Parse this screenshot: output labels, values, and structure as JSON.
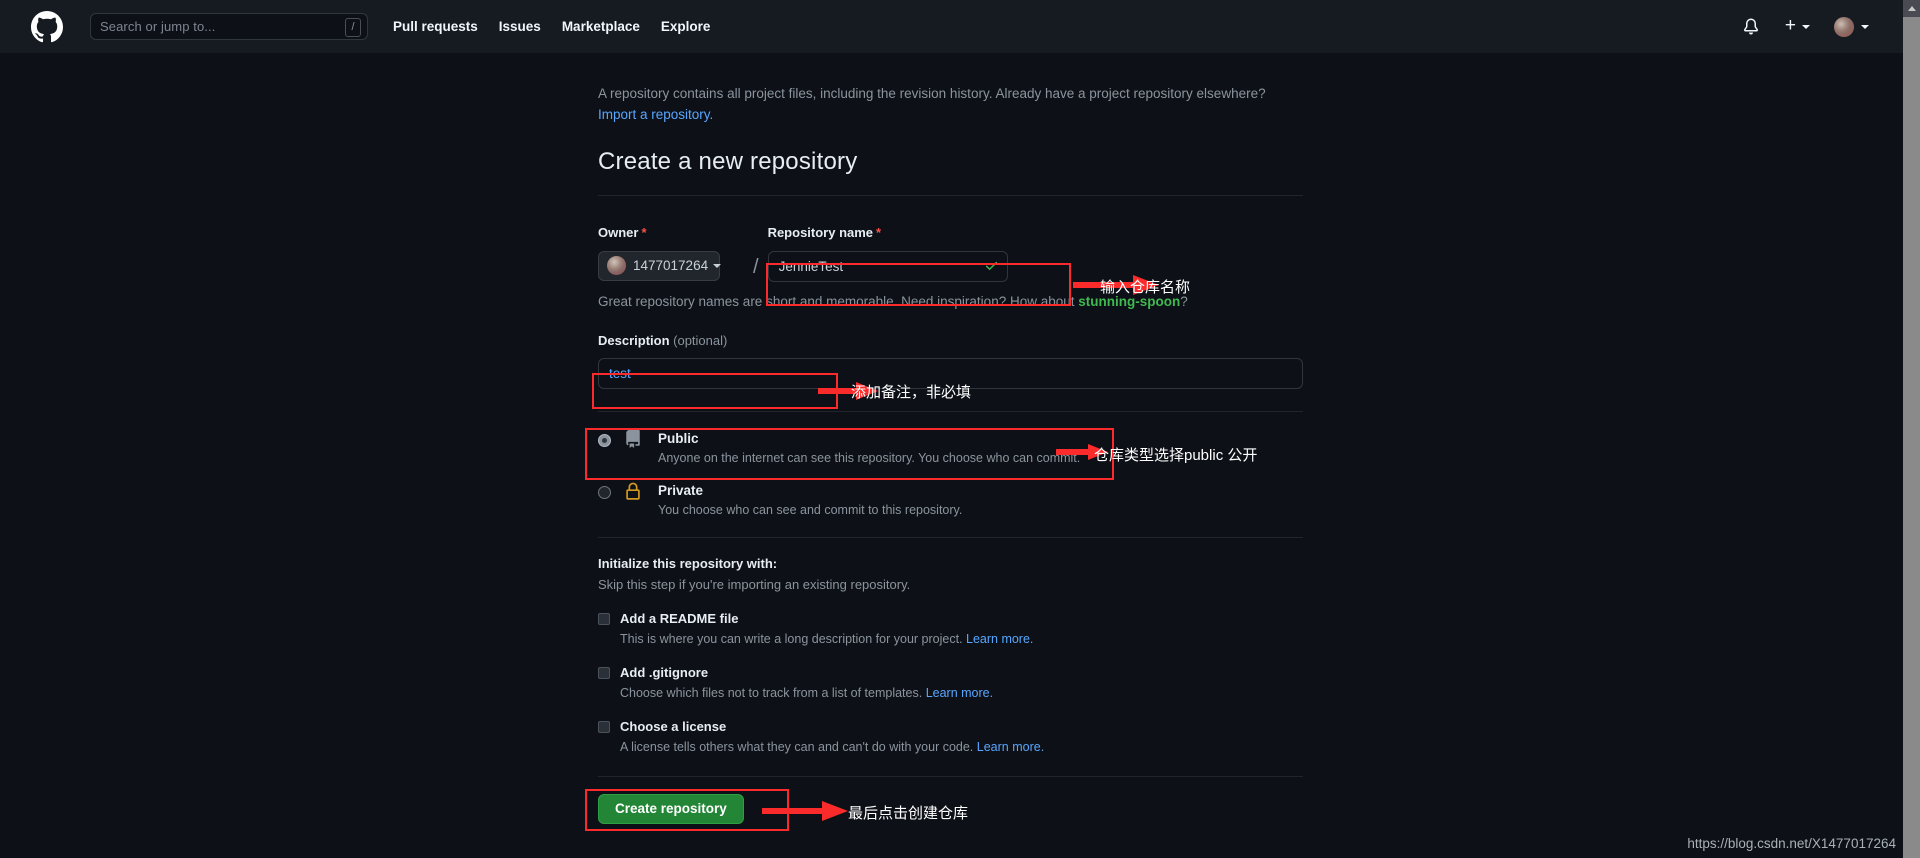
{
  "header": {
    "logo_icon": "github-logo-icon",
    "search": {
      "placeholder": "Search or jump to...",
      "shortcut_key": "/"
    },
    "nav": [
      {
        "label": "Pull requests"
      },
      {
        "label": "Issues"
      },
      {
        "label": "Marketplace"
      },
      {
        "label": "Explore"
      }
    ],
    "notifications_icon": "bell-icon",
    "create_new_icon": "plus-icon",
    "avatar_icon": "user-avatar"
  },
  "intro": {
    "text": "A repository contains all project files, including the revision history. Already have a project repository elsewhere?",
    "import_link": "Import a repository."
  },
  "page_title": "Create a new repository",
  "owner": {
    "label": "Owner",
    "required_marker": "*",
    "value": "1477017264"
  },
  "repo_name": {
    "label": "Repository name",
    "required_marker": "*",
    "value": "JennieTest",
    "valid_icon": "check-icon",
    "separator": "/"
  },
  "hint": {
    "prefix": "Great repository names are short and memorable. Need inspiration? How about ",
    "suggestion": "stunning-spoon",
    "suffix": "?"
  },
  "description": {
    "label": "Description",
    "optional": "(optional)",
    "value": "test"
  },
  "visibility": [
    {
      "id": "public",
      "icon": "repo-book-icon",
      "title": "Public",
      "subtitle": "Anyone on the internet can see this repository. You choose who can commit.",
      "selected": true
    },
    {
      "id": "private",
      "icon": "lock-icon",
      "title": "Private",
      "subtitle": "You choose who can see and commit to this repository.",
      "selected": false
    }
  ],
  "initialize": {
    "heading": "Initialize this repository with:",
    "subheading": "Skip this step if you're importing an existing repository.",
    "options": [
      {
        "title": "Add a README file",
        "subtitle": "This is where you can write a long description for your project. ",
        "link": "Learn more.",
        "checked": false
      },
      {
        "title": "Add .gitignore",
        "subtitle": "Choose which files not to track from a list of templates. ",
        "link": "Learn more.",
        "checked": false
      },
      {
        "title": "Choose a license",
        "subtitle": "A license tells others what they can and can't do with your code. ",
        "link": "Learn more.",
        "checked": false
      }
    ]
  },
  "submit": {
    "label": "Create repository"
  },
  "annotations": [
    {
      "id": "repo-name-note",
      "text": "输入仓库名称"
    },
    {
      "id": "description-note",
      "text": "添加备注，非必填"
    },
    {
      "id": "visibility-note",
      "text": "仓库类型选择public  公开"
    },
    {
      "id": "submit-note",
      "text": "最后点击创建仓库"
    }
  ],
  "watermark": "https://blog.csdn.net/X1477017264",
  "colors": {
    "page_bg": "#0d1117",
    "header_bg": "#161b22",
    "accent_link": "#58a6ff",
    "green_button": "#238636",
    "green_suggestion": "#3fb950",
    "required_red": "#f85149",
    "annotation_red": "#fb2b2b",
    "lock_yellow": "#d29922"
  }
}
